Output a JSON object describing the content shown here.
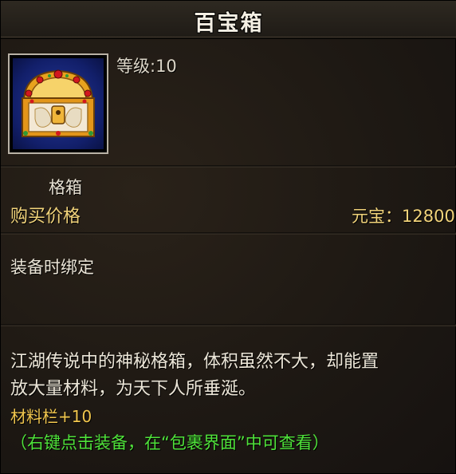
{
  "item": {
    "name": "百宝箱",
    "level_text": "等级:10",
    "category": "格箱",
    "icon": "treasure-chest-icon"
  },
  "price": {
    "label": "购买价格",
    "value_text": "元宝：12800"
  },
  "binding": "装备时绑定",
  "description": {
    "line1": "江湖传说中的神秘格箱，体积虽然不大，却能置",
    "line2": "放大量材料，为天下人所垂涎。"
  },
  "attribute": "材料栏+10",
  "hint": "（右键点击装备，在“包裹界面”中可查看）",
  "colors": {
    "title": "#f4efe4",
    "price": "#f1d37a",
    "attribute": "#f2c74e",
    "hint": "#4fe23a",
    "icon_bg": "#121f6a"
  }
}
